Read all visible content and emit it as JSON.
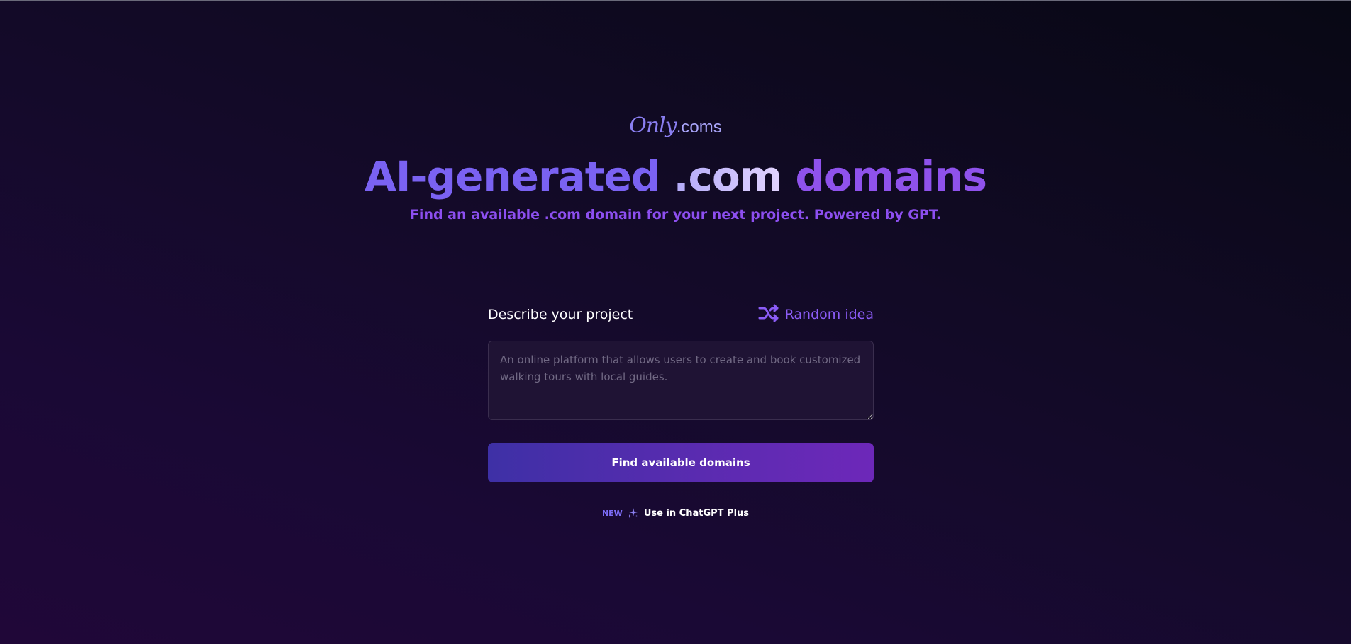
{
  "logo": {
    "script": "Only",
    "suffix": ".coms"
  },
  "hero": {
    "title_part1": "AI-generated ",
    "title_part2": ".com",
    "title_part3": " domains",
    "subtitle": "Find an available .com domain for your next project. Powered by GPT."
  },
  "form": {
    "label": "Describe your project",
    "random_label": "Random idea",
    "random_icon": "shuffle-icon",
    "placeholder": "An online platform that allows users to create and book customized walking tours with local guides.",
    "value": "",
    "submit_label": "Find available domains"
  },
  "promo": {
    "badge": "NEW",
    "icon": "sparkle-icon",
    "link_label": "Use in ChatGPT Plus"
  },
  "colors": {
    "accent": "#8b5cf6",
    "title_blue": "#7a62f2",
    "button_start": "#3e30a6",
    "button_end": "#6d28b9"
  }
}
